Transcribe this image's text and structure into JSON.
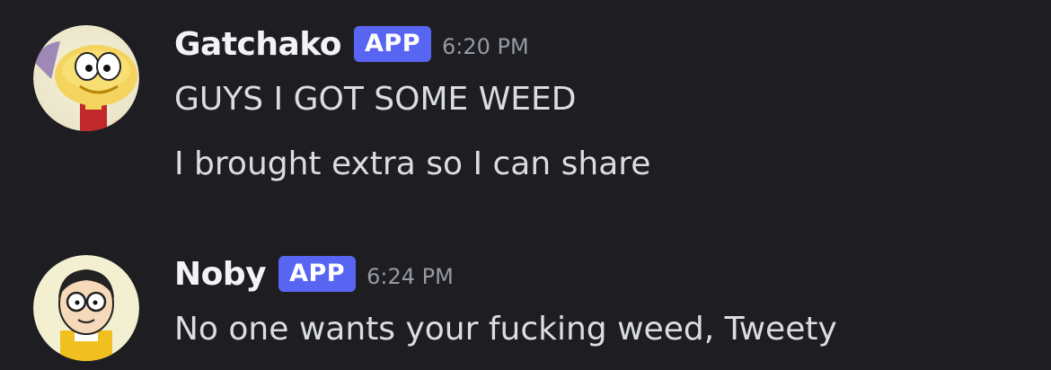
{
  "messages": [
    {
      "username": "Gatchako",
      "tag": "APP",
      "timestamp": "6:20 PM",
      "avatar_icon": "yellow-cartoon-character-avatar",
      "lines": [
        "GUYS I GOT SOME WEED",
        "I brought extra so I can share"
      ]
    },
    {
      "username": "Noby",
      "tag": "APP",
      "timestamp": "6:24 PM",
      "avatar_icon": "boy-with-glasses-cartoon-avatar",
      "lines": [
        "No one wants your fucking weed, Tweety"
      ]
    }
  ],
  "colors": {
    "background": "#1e1e22",
    "username": "#f2f3f5",
    "app_tag_bg": "#5865f2",
    "timestamp": "#949ba4",
    "message_text": "#dbdee1"
  }
}
